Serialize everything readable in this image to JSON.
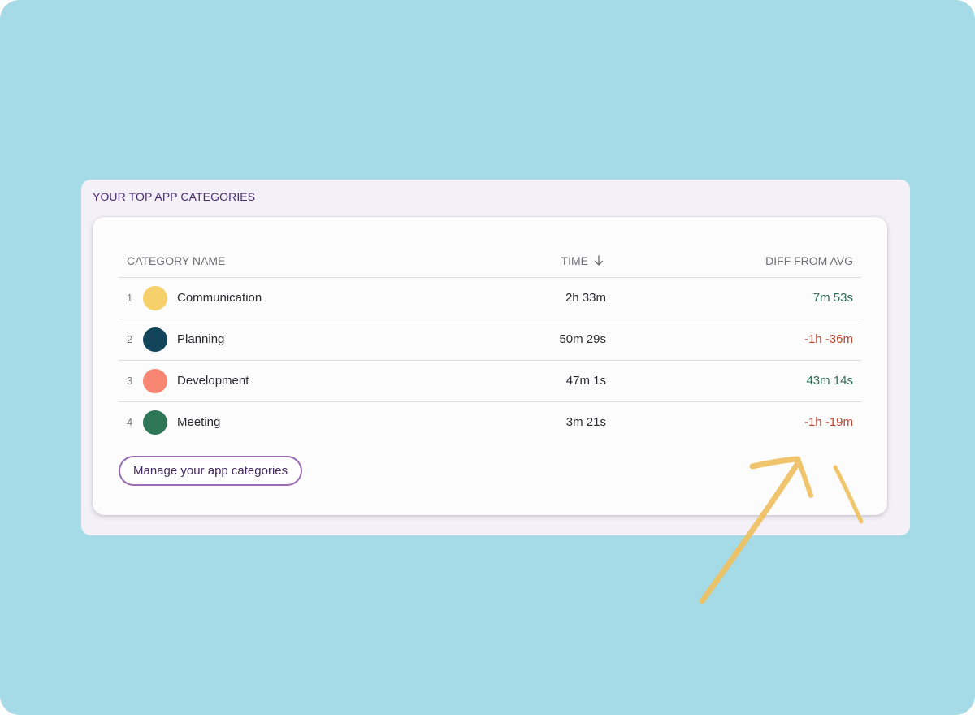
{
  "section_title": "YOUR TOP APP CATEGORIES",
  "table": {
    "headers": {
      "category_name": "CATEGORY NAME",
      "time": "TIME",
      "diff": "DIFF FROM AVG"
    },
    "sort_icon": "arrow-down-icon",
    "rows": [
      {
        "rank": "1",
        "name": "Communication",
        "color": "#f6d06b",
        "time": "2h 33m",
        "diff": "7m 53s",
        "diff_status": "positive"
      },
      {
        "rank": "2",
        "name": "Planning",
        "color": "#13455a",
        "time": "50m 29s",
        "diff": "-1h -36m",
        "diff_status": "negative"
      },
      {
        "rank": "3",
        "name": "Development",
        "color": "#f68672",
        "time": "47m 1s",
        "diff": "43m 14s",
        "diff_status": "positive"
      },
      {
        "rank": "4",
        "name": "Meeting",
        "color": "#2f7657",
        "time": "3m 21s",
        "diff": "-1h -19m",
        "diff_status": "negative"
      }
    ]
  },
  "manage_button": "Manage your app categories",
  "colors": {
    "background": "#a4dbe7",
    "positive": "#2e7156",
    "negative": "#c0432c",
    "annotation": "#f0c060"
  }
}
